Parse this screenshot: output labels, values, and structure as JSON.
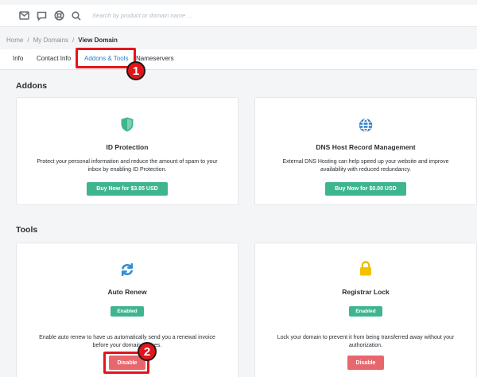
{
  "search": {
    "placeholder": "Search by product or domain name ..."
  },
  "breadcrumb": {
    "home": "Home",
    "sep1": "/",
    "my_domains": "My Domains",
    "sep2": "/",
    "current": "View Domain"
  },
  "tabs": [
    {
      "label": "Info"
    },
    {
      "label": "Contact Info"
    },
    {
      "label": "Addons & Tools"
    },
    {
      "label": "Nameservers"
    }
  ],
  "annotations": {
    "first": "1",
    "second": "2"
  },
  "addons": {
    "title": "Addons",
    "id_protection": {
      "title": "ID Protection",
      "desc1": "Protect your personal information and reduce the amount of spam to your",
      "desc2": "inbox by enabling ID Protection.",
      "button": "Buy Now for $3.95 USD",
      "icon": "shield-icon"
    },
    "dns": {
      "title": "DNS Host Record Management",
      "desc1": "External DNS Hosting can help speed up your website and improve",
      "desc2": "availability with reduced redundancy.",
      "button": "Buy Now for $0.00 USD",
      "icon": "globe-icon"
    }
  },
  "tools": {
    "title": "Tools",
    "auto_renew": {
      "title": "Auto Renew",
      "status": "Enabled",
      "desc1": "Enable auto renew to have us automatically send you a renewal invoice",
      "desc2": "before your domain expires.",
      "button": "Disable",
      "icon": "refresh-icon"
    },
    "registrar_lock": {
      "title": "Registrar Lock",
      "status": "Enabled",
      "desc1": "Lock your domain to prevent it from being transferred away without your",
      "desc2": "authorization.",
      "button": "Disable",
      "icon": "lock-icon"
    }
  },
  "colors": {
    "accent": "#2f7ec7",
    "success": "#3fb58f",
    "danger": "#e8676d",
    "annotation": "#e3151b"
  }
}
